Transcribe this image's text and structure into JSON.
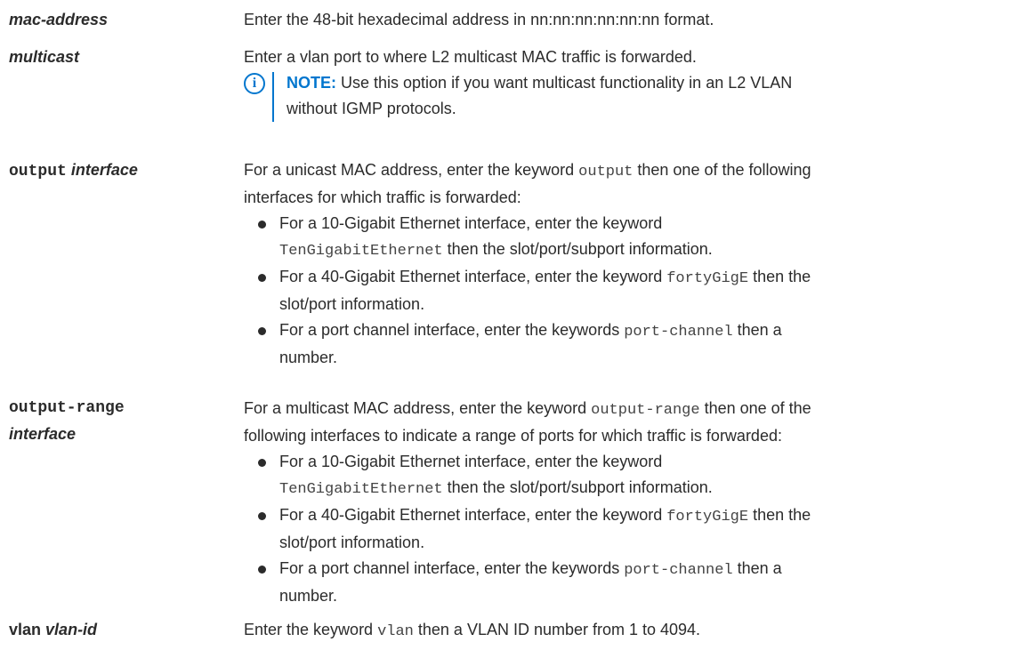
{
  "rows": {
    "mac_address": {
      "term": "mac-address",
      "desc": "Enter the 48-bit hexadecimal address in nn:nn:nn:nn:nn:nn format."
    },
    "multicast": {
      "term": "multicast",
      "desc": "Enter a vlan port to where L2 multicast MAC traffic is forwarded.",
      "note_label": "NOTE:",
      "note_line1": " Use this option if you want multicast functionality in an L2 VLAN",
      "note_line2": "without IGMP protocols."
    },
    "output": {
      "term_kw": "output",
      "term_arg": "interface",
      "desc_pre": "For a unicast MAC address, enter the keyword ",
      "desc_kw": "output",
      "desc_post": " then one of the following",
      "desc_line2": "interfaces for which traffic is forwarded:",
      "bullets": [
        {
          "l1": "For a 10-Gigabit Ethernet interface, enter the keyword",
          "kw": "TenGigabitEthernet",
          "post": " then the slot/port/subport information."
        },
        {
          "pre": "For a 40-Gigabit Ethernet interface, enter the keyword ",
          "kw": "fortyGigE",
          "post": " then the",
          "l2": "slot/port information."
        },
        {
          "pre": "For a port channel interface, enter the keywords ",
          "kw": "port-channel",
          "post": " then a",
          "l2": "number."
        }
      ]
    },
    "output_range": {
      "term_kw": "output-range",
      "term_arg": "interface",
      "desc_pre": "For a multicast MAC address, enter the keyword ",
      "desc_kw": "output-range",
      "desc_post": " then one of the",
      "desc_line2": "following interfaces to indicate a range of ports for which traffic is forwarded:",
      "bullets": [
        {
          "l1": "For a 10-Gigabit Ethernet interface, enter the keyword",
          "kw": "TenGigabitEthernet",
          "post": " then the slot/port/subport information."
        },
        {
          "pre": "For a 40-Gigabit Ethernet interface, enter the keyword ",
          "kw": "fortyGigE",
          "post": " then the",
          "l2": "slot/port information."
        },
        {
          "pre": "For a port channel interface, enter the keywords ",
          "kw": "port-channel",
          "post": " then a",
          "l2": "number."
        }
      ]
    },
    "vlan": {
      "term_kw": "vlan",
      "term_arg": "vlan-id",
      "desc_pre": "Enter the keyword ",
      "desc_kw": "vlan",
      "desc_post": " then a VLAN ID number from 1 to 4094."
    }
  },
  "colors": {
    "accent": "#0076ce",
    "text": "#2b2b2b"
  },
  "icons": {
    "note": "info-icon",
    "bullet": "bullet-icon"
  }
}
